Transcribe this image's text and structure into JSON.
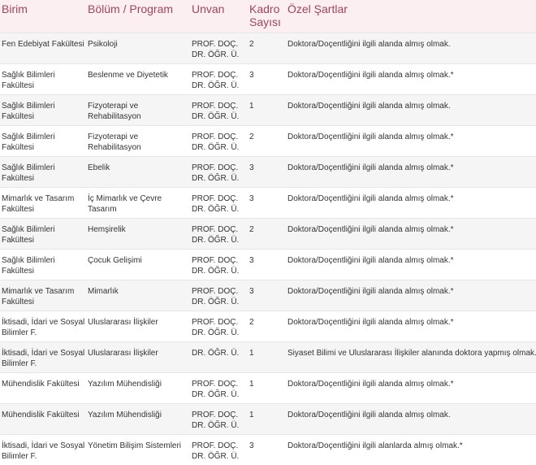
{
  "columns": [
    "Birim",
    "Bölüm / Program",
    "Unvan",
    "Kadro\nSayısı",
    "Özel Şartlar"
  ],
  "rows": [
    [
      "Fen Edebiyat Fakültesi",
      "Psikoloji",
      "PROF. DOÇ.\nDR. ÖĞR. Ü.",
      "2",
      "Doktora/Doçentliğini ilgili alanda almış olmak."
    ],
    [
      "Sağlık Bilimleri\nFakültesi",
      "Beslenme ve Diyetetik",
      "PROF. DOÇ.\nDR. ÖĞR. Ü.",
      "3",
      "Doktora/Doçentliğini ilgili alanda almış olmak.*"
    ],
    [
      "Sağlık Bilimleri\nFakültesi",
      "Fizyoterapi ve\nRehabilitasyon",
      "PROF. DOÇ.\nDR. ÖĞR. Ü.",
      "1",
      "Doktora/Doçentliğini ilgili alanda almış olmak."
    ],
    [
      "Sağlık Bilimleri\nFakültesi",
      "Fizyoterapi ve\nRehabilitasyon",
      "PROF. DOÇ.\nDR. ÖĞR. Ü.",
      "2",
      "Doktora/Doçentliğini ilgili alanda almış olmak.*"
    ],
    [
      "Sağlık Bilimleri\nFakültesi",
      "Ebelik",
      "PROF. DOÇ.\nDR. ÖĞR. Ü.",
      "3",
      "Doktora/Doçentliğini ilgili alanda almış olmak.*"
    ],
    [
      "Mimarlık ve Tasarım\nFakültesi",
      "İç Mimarlık ve Çevre\nTasarım",
      "PROF. DOÇ.\nDR. ÖĞR. Ü.",
      "3",
      "Doktora/Doçentliğini ilgili alanda almış olmak.*"
    ],
    [
      "Sağlık Bilimleri\nFakültesi",
      "Hemşirelik",
      "PROF. DOÇ.\nDR. ÖĞR. Ü.",
      "2",
      "Doktora/Doçentliğini ilgili alanda almış olmak.*"
    ],
    [
      "Sağlık Bilimleri\nFakültesi",
      "Çocuk Gelişimi",
      "PROF. DOÇ.\nDR. ÖĞR. Ü.",
      "3",
      "Doktora/Doçentliğini ilgili alanda almış olmak.*"
    ],
    [
      "Mimarlık ve Tasarım\nFakültesi",
      "Mimarlık",
      "PROF. DOÇ.\nDR. ÖĞR. Ü.",
      "3",
      "Doktora/Doçentliğini ilgili alanda almış olmak.*"
    ],
    [
      "İktisadi, İdari ve Sosyal\nBilimler F.",
      "Uluslararası İlişkiler",
      "PROF. DOÇ.\nDR. ÖĞR. Ü.",
      "2",
      "Doktora/Doçentliğini ilgili alanda almış olmak.*"
    ],
    [
      "İktisadi, İdari ve Sosyal\nBilimler F.",
      "Uluslararası İlişkiler",
      "DR. ÖĞR. Ü.",
      "1",
      "Siyaset Bilimi ve Uluslararası İlişkiler alanında doktora yapmış olmak.*"
    ],
    [
      "Mühendislik Fakültesi",
      "Yazılım Mühendisliği",
      "PROF. DOÇ.\nDR. ÖĞR. Ü.",
      "1",
      "Doktora/Doçentliğini ilgili alanda almış olmak.*"
    ],
    [
      "Mühendislik Fakültesi",
      "Yazılım Mühendisliği",
      "PROF. DOÇ.\nDR. ÖĞR. Ü.",
      "1",
      "Doktora/Doçentliğini ilgili alanda almış olmak."
    ],
    [
      "İktisadi, İdari ve Sosyal\nBilimler F.",
      "Yönetim Bilişim Sistemleri",
      "PROF. DOÇ.\nDR. ÖĞR. Ü.",
      "3",
      "Doktora/Doçentliğini ilgili alanlarda almış olmak.*"
    ]
  ]
}
